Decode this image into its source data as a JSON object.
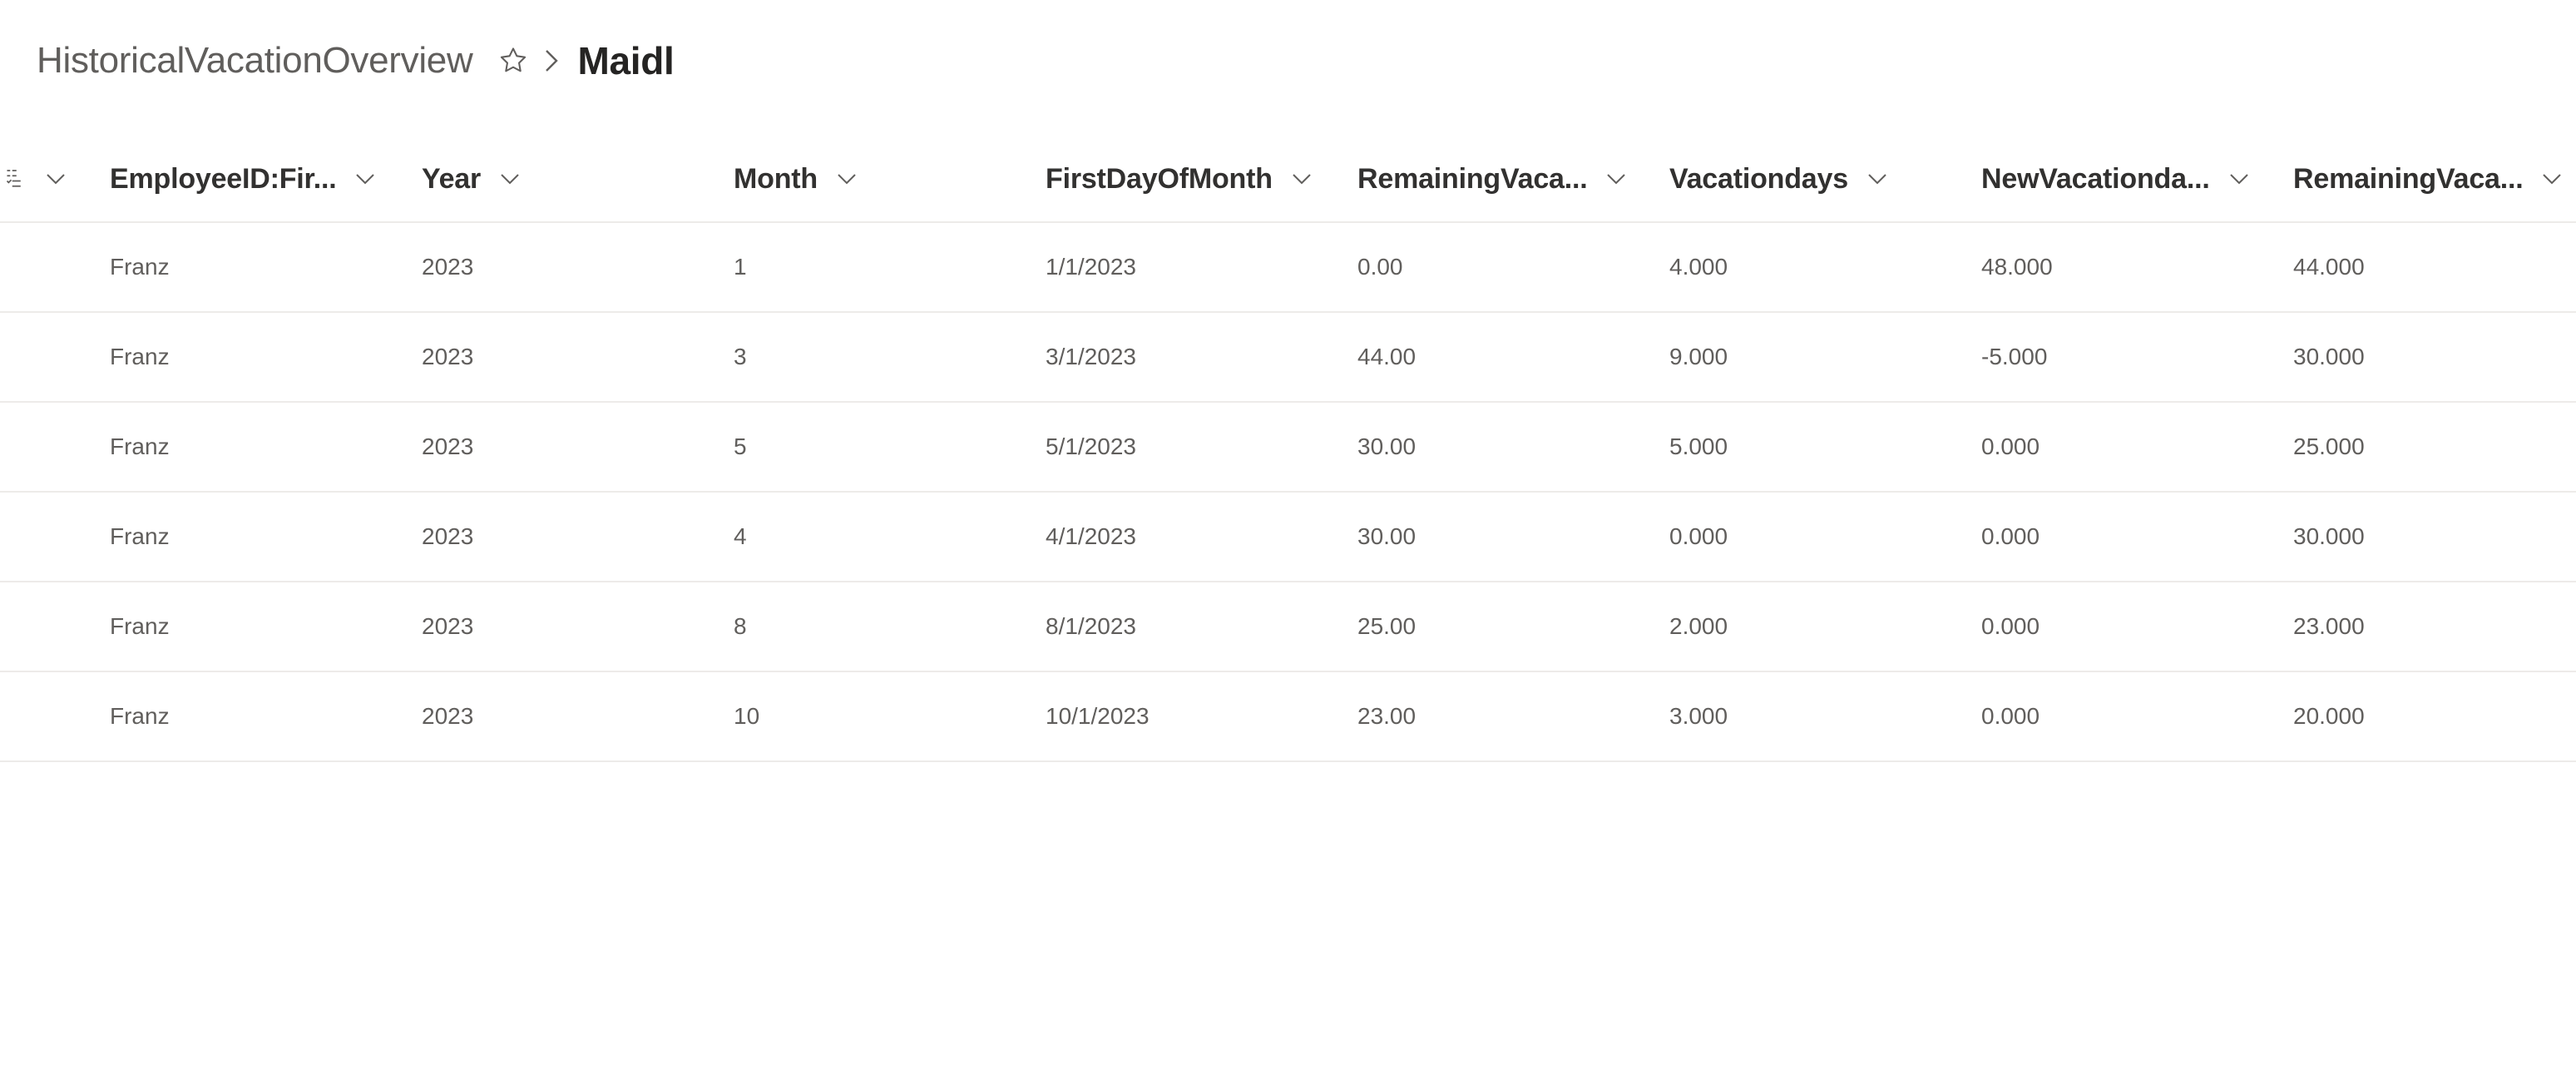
{
  "breadcrumb": {
    "list_title": "HistoricalVacationOverview",
    "current_view": "Maidl"
  },
  "table": {
    "columns": [
      "EmployeeID:Fir...",
      "Year",
      "Month",
      "FirstDayOfMonth",
      "RemainingVaca...",
      "Vacationdays",
      "NewVacationda...",
      "RemainingVaca..."
    ],
    "rows": [
      [
        "Franz",
        "2023",
        "1",
        "1/1/2023",
        "0.00",
        "4.000",
        "48.000",
        "44.000"
      ],
      [
        "Franz",
        "2023",
        "3",
        "3/1/2023",
        "44.00",
        "9.000",
        "-5.000",
        "30.000"
      ],
      [
        "Franz",
        "2023",
        "5",
        "5/1/2023",
        "30.00",
        "5.000",
        "0.000",
        "25.000"
      ],
      [
        "Franz",
        "2023",
        "4",
        "4/1/2023",
        "30.00",
        "0.000",
        "0.000",
        "30.000"
      ],
      [
        "Franz",
        "2023",
        "8",
        "8/1/2023",
        "25.00",
        "2.000",
        "0.000",
        "23.000"
      ],
      [
        "Franz",
        "2023",
        "10",
        "10/1/2023",
        "23.00",
        "3.000",
        "0.000",
        "20.000"
      ]
    ]
  },
  "icons": {
    "favorite": "star-outline-icon",
    "separator": "chevron-right-icon",
    "column_menu": "chevron-down-icon",
    "row_select": "list-select-icon"
  },
  "colors": {
    "header_text": "#323130",
    "cell_text": "#605e5c",
    "divider": "#edebe9"
  }
}
